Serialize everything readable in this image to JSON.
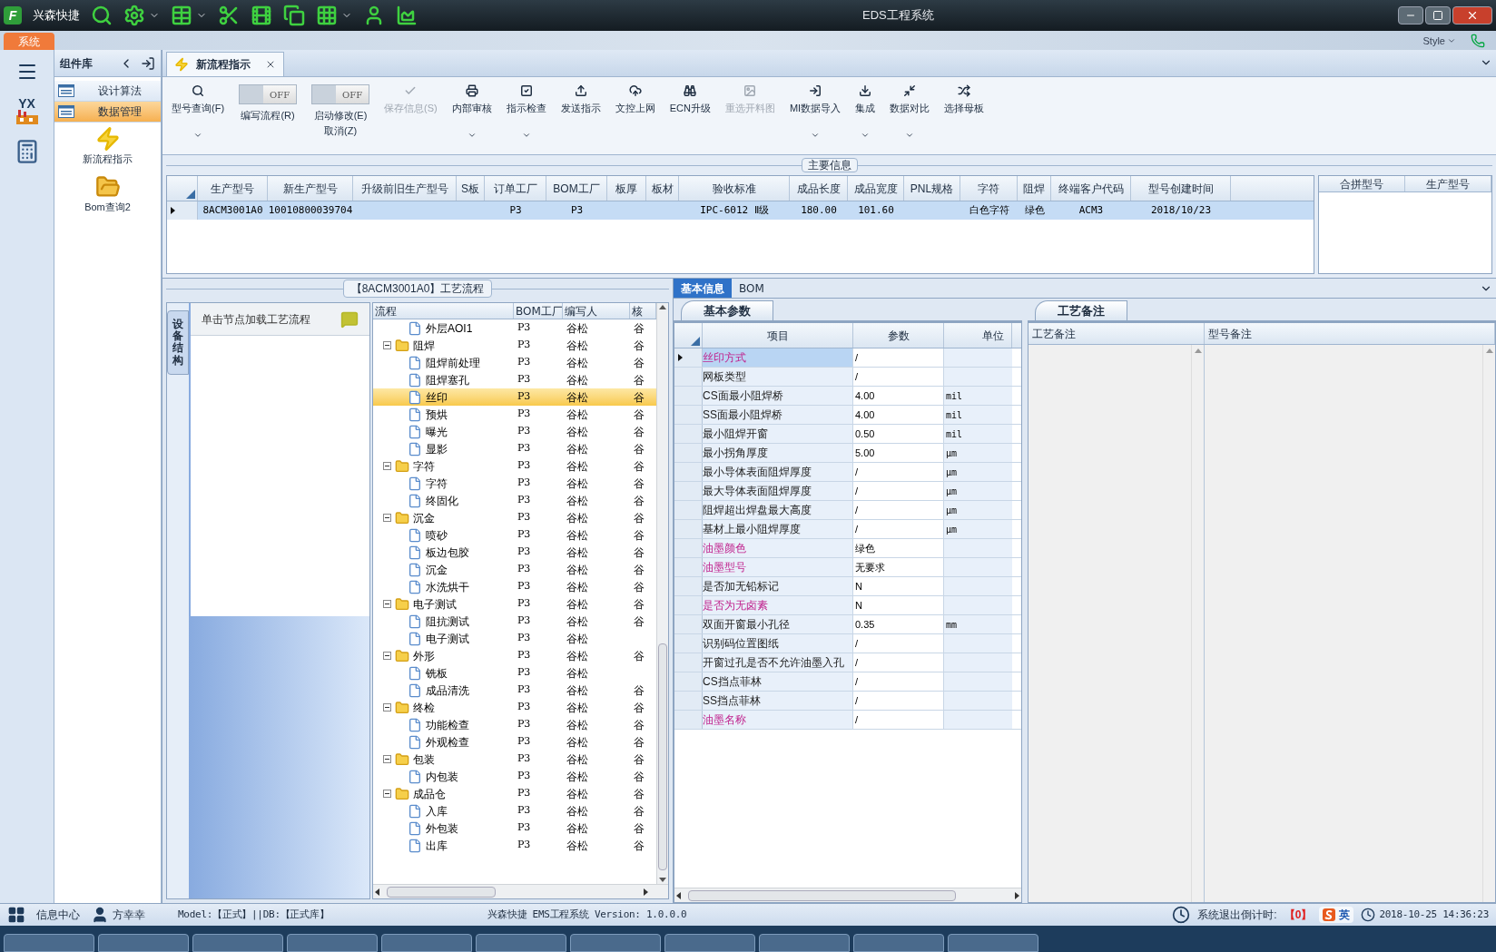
{
  "window": {
    "title": "EDS工程系统",
    "app_name": "兴森快捷",
    "logo_letter": "F"
  },
  "menu": {
    "system_tab": "系统",
    "style_menu": "Style"
  },
  "left_rail": {
    "logo_text": "YX"
  },
  "sidebar": {
    "title": "组件库",
    "items": [
      {
        "label": "设计算法",
        "kind": "list",
        "selected": false
      },
      {
        "label": "数据管理",
        "kind": "list",
        "selected": true
      },
      {
        "label": "新流程指示",
        "kind": "launcher"
      },
      {
        "label": "Bom查询2",
        "kind": "launcher"
      }
    ]
  },
  "tabs": [
    {
      "label": "新流程指示",
      "selected": true,
      "closable": true
    }
  ],
  "toolbar": {
    "items": [
      {
        "kind": "button",
        "label": "型号查询(F)",
        "disabled": false,
        "dropdown": true
      },
      {
        "kind": "toggle",
        "label": "编写流程(R)",
        "on": false,
        "switch_text": "OFF"
      },
      {
        "kind": "toggle",
        "label": "启动修改(E)",
        "sublabel": "取消(Z)",
        "on": false,
        "switch_text": "OFF"
      },
      {
        "kind": "button",
        "label": "保存信息(S)",
        "disabled": true,
        "dropdown": false
      },
      {
        "kind": "button",
        "label": "内部审核",
        "disabled": false,
        "dropdown": true
      },
      {
        "kind": "button",
        "label": "指示检查",
        "disabled": false,
        "dropdown": true
      },
      {
        "kind": "button",
        "label": "发送指示",
        "disabled": false,
        "dropdown": false
      },
      {
        "kind": "button",
        "label": "文控上网",
        "disabled": false,
        "dropdown": false
      },
      {
        "kind": "button",
        "label": "ECN升级",
        "disabled": false,
        "dropdown": false
      },
      {
        "kind": "button",
        "label": "重选开料图",
        "disabled": true,
        "dropdown": false
      },
      {
        "kind": "button",
        "label": "MI数据导入",
        "disabled": false,
        "dropdown": true
      },
      {
        "kind": "button",
        "label": "集成",
        "disabled": false,
        "dropdown": true
      },
      {
        "kind": "button",
        "label": "数据对比",
        "disabled": false,
        "dropdown": true
      },
      {
        "kind": "button",
        "label": "选择母板",
        "disabled": false,
        "dropdown": false
      }
    ]
  },
  "main_info": {
    "title": "主要信息",
    "table": {
      "columns": [
        "生产型号",
        "新生产型号",
        "升级前旧生产型号",
        "S板",
        "订单工厂",
        "BOM工厂",
        "板厚",
        "板材",
        "验收标准",
        "成品长度",
        "成品宽度",
        "PNL规格",
        "字符",
        "阻焊",
        "终端客户代码",
        "型号创建时间"
      ],
      "rows": [
        {
          "selected": true,
          "cells": [
            "8ACM3001A0",
            "10010800039704",
            "",
            "",
            "P3",
            "P3",
            "",
            "",
            "IPC-6012 Ⅱ级",
            "180.00",
            "101.60",
            "",
            "白色字符",
            "绿色",
            "ACM3",
            "2018/10/23"
          ]
        }
      ]
    },
    "merge_table": {
      "columns": [
        "合拼型号",
        "生产型号"
      ]
    }
  },
  "process_panel": {
    "title": "【8ACM3001A0】工艺流程",
    "side_tab": "设备结构",
    "hint": "单击节点加载工艺流程",
    "tree": {
      "columns": [
        "流程",
        "BOM工厂",
        "编写人",
        "核"
      ],
      "rows": [
        {
          "children": [
            {
              "label": "外层AOI1",
              "bom_factory": "P3",
              "writer": "谷松",
              "checker": "谷",
              "selected": false
            }
          ]
        },
        {
          "label": "阻焊",
          "bom_factory": "P3",
          "writer": "谷松",
          "checker": "谷",
          "selected": false,
          "expanded": true,
          "children": [
            {
              "label": "阻焊前处理",
              "bom_factory": "P3",
              "writer": "谷松",
              "checker": "谷",
              "selected": false
            },
            {
              "label": "阻焊塞孔",
              "bom_factory": "P3",
              "writer": "谷松",
              "checker": "谷",
              "selected": false
            },
            {
              "label": "丝印",
              "bom_factory": "P3",
              "writer": "谷松",
              "checker": "谷",
              "selected": true
            },
            {
              "label": "预烘",
              "bom_factory": "P3",
              "writer": "谷松",
              "checker": "谷",
              "selected": false
            },
            {
              "label": "曝光",
              "bom_factory": "P3",
              "writer": "谷松",
              "checker": "谷",
              "selected": false
            },
            {
              "label": "显影",
              "bom_factory": "P3",
              "writer": "谷松",
              "checker": "谷",
              "selected": false
            }
          ]
        },
        {
          "label": "字符",
          "bom_factory": "P3",
          "writer": "谷松",
          "checker": "谷",
          "selected": false,
          "expanded": true,
          "children": [
            {
              "label": "字符",
              "bom_factory": "P3",
              "writer": "谷松",
              "checker": "谷",
              "selected": false
            },
            {
              "label": "终固化",
              "bom_factory": "P3",
              "writer": "谷松",
              "checker": "谷",
              "selected": false
            }
          ]
        },
        {
          "label": "沉金",
          "bom_factory": "P3",
          "writer": "谷松",
          "checker": "谷",
          "selected": false,
          "expanded": true,
          "children": [
            {
              "label": "喷砂",
              "bom_factory": "P3",
              "writer": "谷松",
              "checker": "谷",
              "selected": false
            },
            {
              "label": "板边包胶",
              "bom_factory": "P3",
              "writer": "谷松",
              "checker": "谷",
              "selected": false
            },
            {
              "label": "沉金",
              "bom_factory": "P3",
              "writer": "谷松",
              "checker": "谷",
              "selected": false
            },
            {
              "label": "水洗烘干",
              "bom_factory": "P3",
              "writer": "谷松",
              "checker": "谷",
              "selected": false
            }
          ]
        },
        {
          "label": "电子测试",
          "bom_factory": "P3",
          "writer": "谷松",
          "checker": "谷",
          "selected": false,
          "expanded": true,
          "children": [
            {
              "label": "阻抗测试",
              "bom_factory": "P3",
              "writer": "谷松",
              "checker": "谷",
              "selected": false
            },
            {
              "label": "电子测试",
              "bom_factory": "P3",
              "writer": "谷松",
              "selected": false
            }
          ]
        },
        {
          "label": "外形",
          "bom_factory": "P3",
          "writer": "谷松",
          "checker": "谷",
          "selected": false,
          "expanded": true,
          "children": [
            {
              "label": "铣板",
              "bom_factory": "P3",
              "writer": "谷松",
              "selected": false
            },
            {
              "label": "成品清洗",
              "bom_factory": "P3",
              "writer": "谷松",
              "checker": "谷",
              "selected": false
            }
          ]
        },
        {
          "label": "终检",
          "bom_factory": "P3",
          "writer": "谷松",
          "checker": "谷",
          "selected": false,
          "expanded": true,
          "children": [
            {
              "label": "功能检查",
              "bom_factory": "P3",
              "writer": "谷松",
              "checker": "谷",
              "selected": false
            },
            {
              "label": "外观检查",
              "bom_factory": "P3",
              "writer": "谷松",
              "checker": "谷",
              "selected": false
            }
          ]
        },
        {
          "label": "包装",
          "bom_factory": "P3",
          "writer": "谷松",
          "checker": "谷",
          "selected": false,
          "expanded": true,
          "children": [
            {
              "label": "内包装",
              "bom_factory": "P3",
              "writer": "谷松",
              "checker": "谷",
              "selected": false
            }
          ]
        },
        {
          "label": "成品仓",
          "bom_factory": "P3",
          "writer": "谷松",
          "checker": "谷",
          "selected": false,
          "expanded": true,
          "children": [
            {
              "label": "入库",
              "bom_factory": "P3",
              "writer": "谷松",
              "checker": "谷",
              "selected": false
            },
            {
              "label": "外包装",
              "bom_factory": "P3",
              "writer": "谷松",
              "checker": "谷",
              "selected": false
            },
            {
              "label": "出库",
              "bom_factory": "P3",
              "writer": "谷松",
              "checker": "谷",
              "selected": false
            }
          ]
        }
      ]
    }
  },
  "detail": {
    "tabs": [
      {
        "label": "基本信息",
        "selected": true
      },
      {
        "label": "BOM",
        "selected": false
      }
    ],
    "params": {
      "tab": "基本参数",
      "columns": [
        "项目",
        "参数",
        "单位"
      ],
      "rows": [
        {
          "item": "丝印方式",
          "value": "/",
          "highlighted": true,
          "selected": true
        },
        {
          "item": "网板类型",
          "value": "/",
          "highlighted": false,
          "selected": false
        },
        {
          "item": "CS面最小阻焊桥",
          "value": "4.00",
          "unit": "mil",
          "highlighted": false,
          "selected": false
        },
        {
          "item": "SS面最小阻焊桥",
          "value": "4.00",
          "unit": "mil",
          "highlighted": false,
          "selected": false
        },
        {
          "item": "最小阻焊开窗",
          "value": "0.50",
          "unit": "mil",
          "highlighted": false,
          "selected": false
        },
        {
          "item": "最小拐角厚度",
          "value": "5.00",
          "unit": "μm",
          "highlighted": false,
          "selected": false
        },
        {
          "item": "最小导体表面阻焊厚度",
          "value": "/",
          "unit": "μm",
          "highlighted": false,
          "selected": false
        },
        {
          "item": "最大导体表面阻焊厚度",
          "value": "/",
          "unit": "μm",
          "highlighted": false,
          "selected": false
        },
        {
          "item": "阻焊超出焊盘最大高度",
          "value": "/",
          "unit": "μm",
          "highlighted": false,
          "selected": false
        },
        {
          "item": "基材上最小阻焊厚度",
          "value": "/",
          "unit": "μm",
          "highlighted": false,
          "selected": false
        },
        {
          "item": "油墨颜色",
          "value": "绿色",
          "highlighted": true,
          "selected": false
        },
        {
          "item": "油墨型号",
          "value": "无要求",
          "highlighted": true,
          "selected": false
        },
        {
          "item": "是否加无铅标记",
          "value": "N",
          "highlighted": false,
          "selected": false
        },
        {
          "item": "是否为无卤素",
          "value": "N",
          "highlighted": true,
          "selected": false
        },
        {
          "item": "双面开窗最小孔径",
          "value": "0.35",
          "unit": "mm",
          "highlighted": false,
          "selected": false
        },
        {
          "item": "识别码位置图纸",
          "value": "/",
          "highlighted": false,
          "selected": false
        },
        {
          "item": "开窗过孔是否不允许油墨入孔",
          "value": "/",
          "highlighted": false,
          "selected": false
        },
        {
          "item": "CS挡点菲林",
          "value": "/",
          "highlighted": false,
          "selected": false
        },
        {
          "item": "SS挡点菲林",
          "value": "/",
          "highlighted": false,
          "selected": false
        },
        {
          "item": "油墨名称",
          "value": "/",
          "highlighted": true,
          "selected": false
        }
      ]
    },
    "notes": {
      "tab": "工艺备注",
      "columns": [
        "工艺备注",
        "型号备注"
      ]
    }
  },
  "status_bar": {
    "info_center": "信息中心",
    "user": "方幸幸",
    "db_info": "Model:【正式】||DB:【正式库】",
    "version": "兴森快捷 EMS工程系统 Version: 1.0.0.0",
    "countdown_label": "系统退出倒计时:",
    "countdown": "【0】",
    "datetime": "2018-10-25 14:36:23",
    "ime": "英"
  }
}
